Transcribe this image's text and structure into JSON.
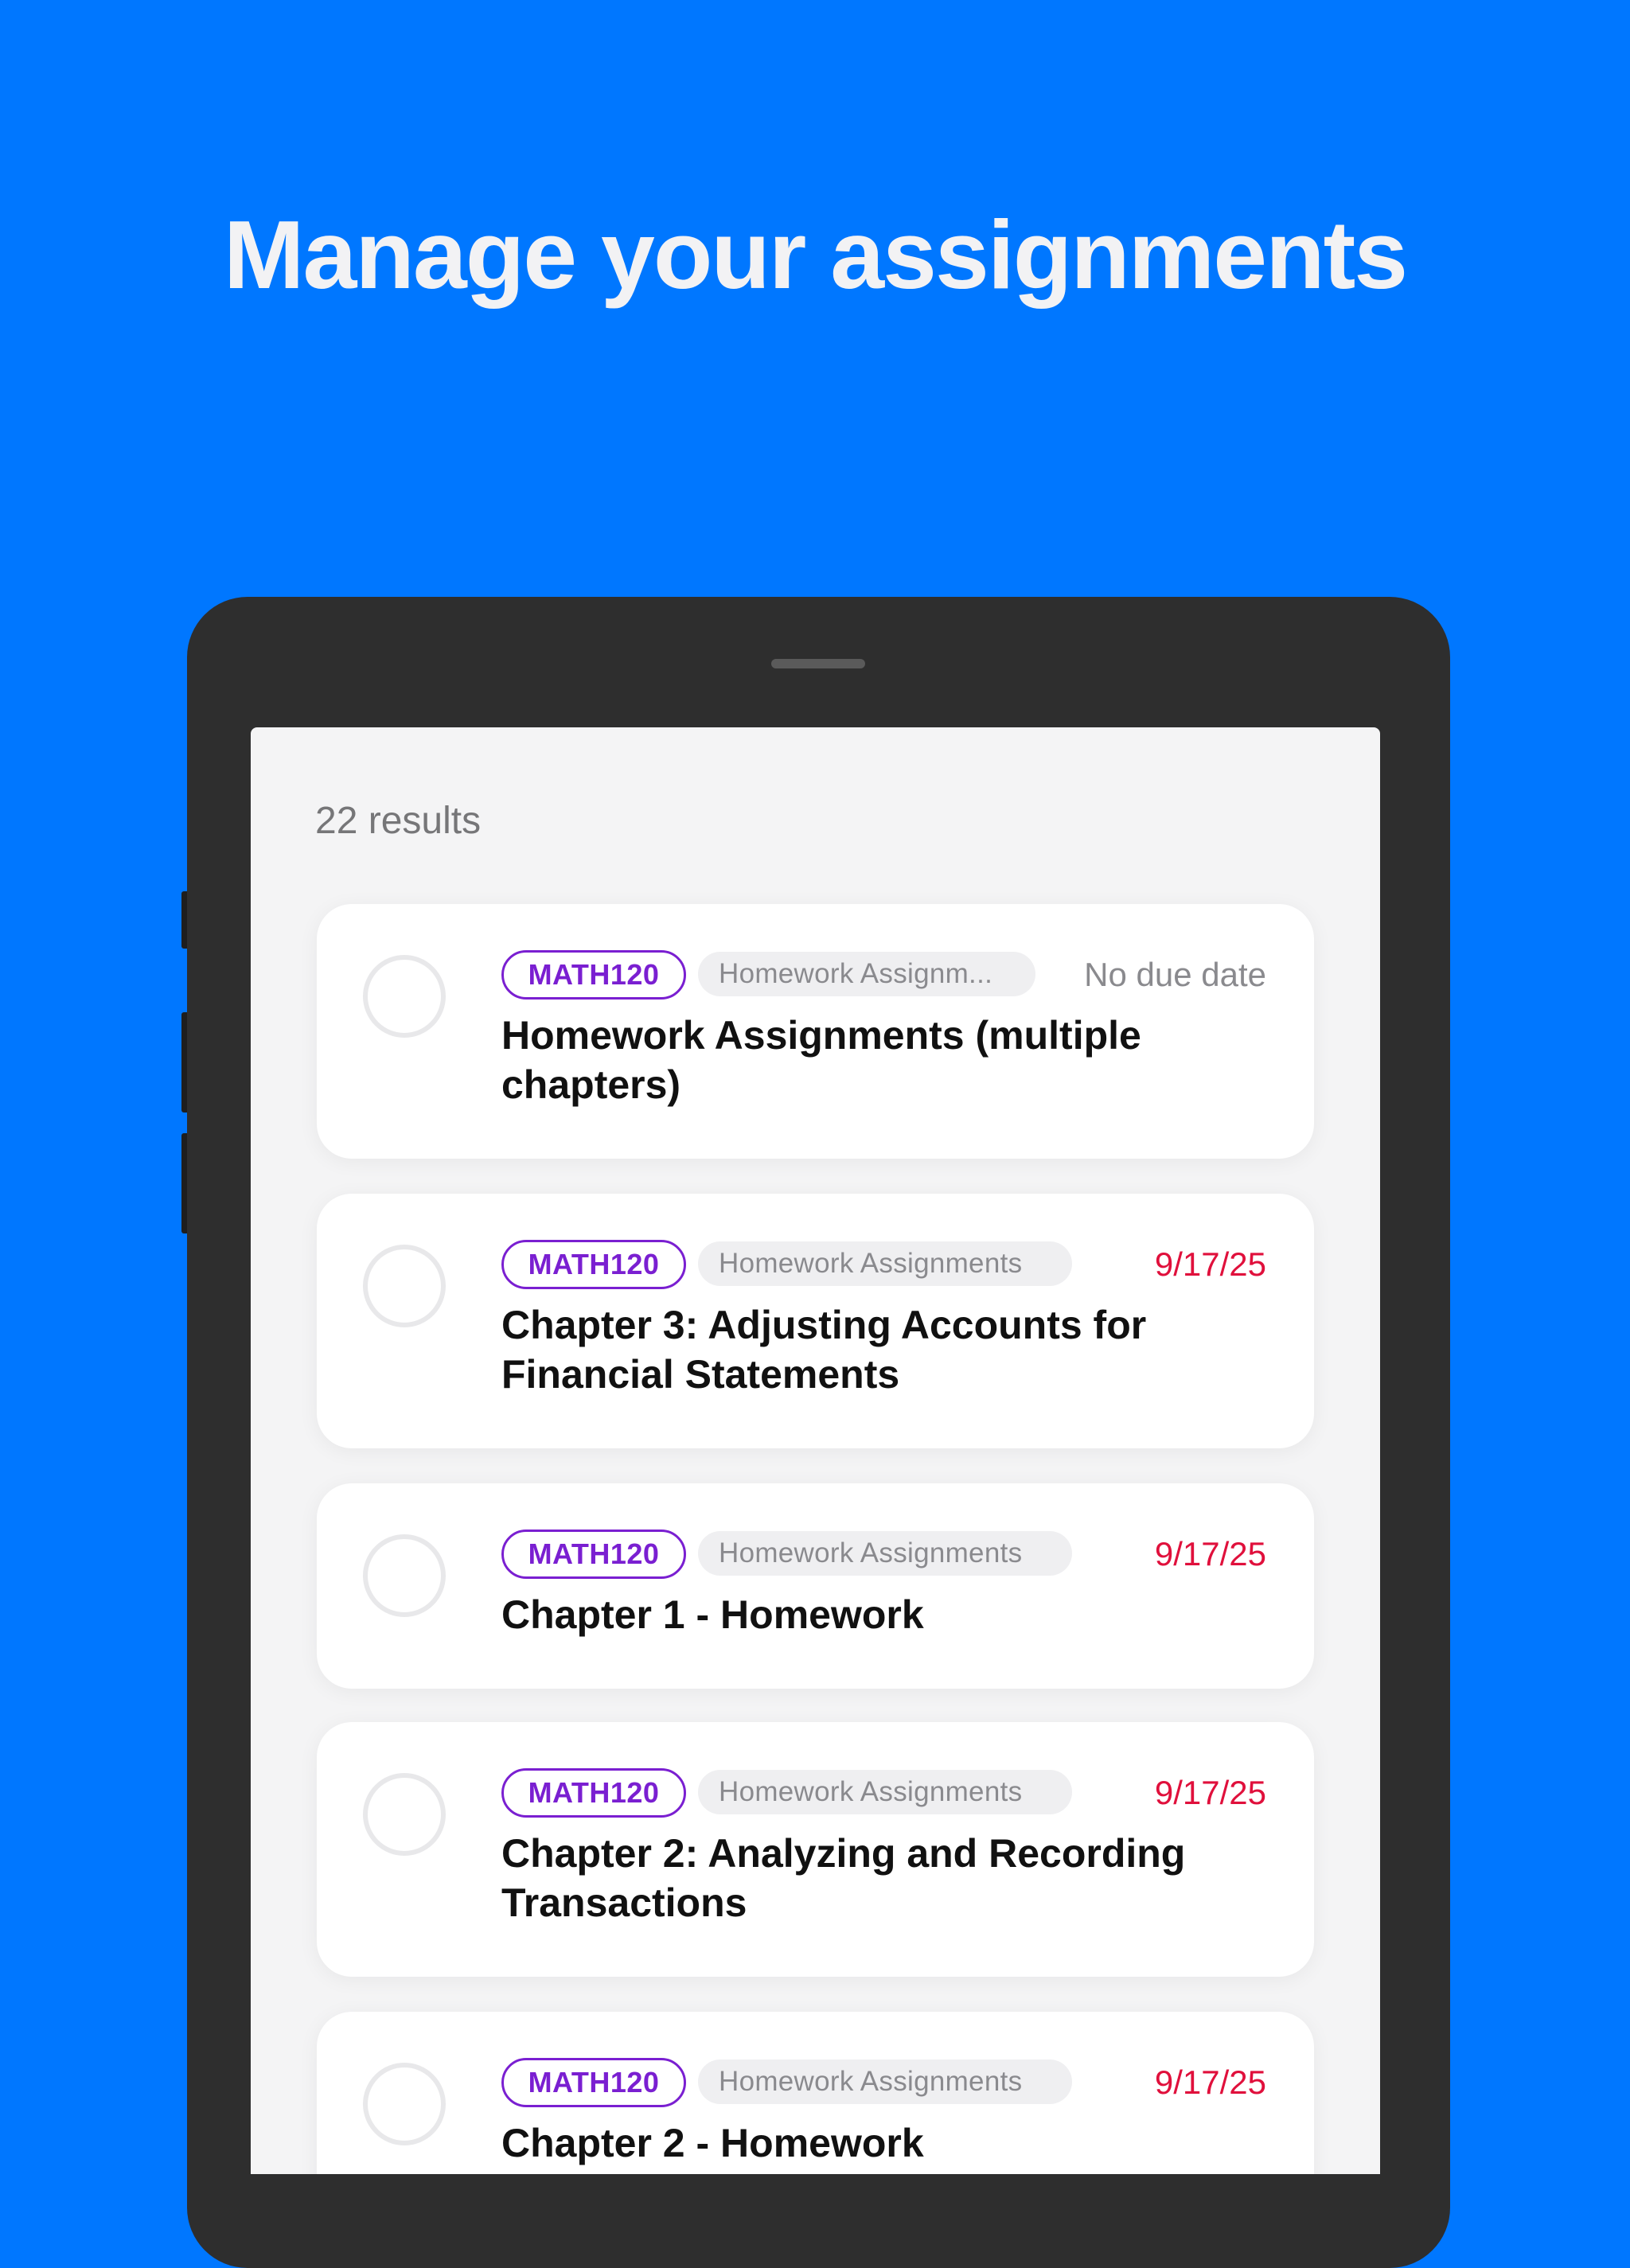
{
  "headline": "Manage your assignments",
  "list": {
    "results_text": "22 results",
    "items": [
      {
        "course": "MATH120",
        "category": "Homework Assignm...",
        "due": "No due date",
        "title": "Homework Assignments (multiple chapters)",
        "completed": false
      },
      {
        "course": "MATH120",
        "category": "Homework Assignments",
        "due": "9/17/25",
        "title": "Chapter 3: Adjusting Accounts for Financial Statements",
        "completed": false
      },
      {
        "course": "MATH120",
        "category": "Homework Assignments",
        "due": "9/17/25",
        "title": "Chapter 1 - Homework",
        "completed": false
      },
      {
        "course": "MATH120",
        "category": "Homework Assignments",
        "due": "9/17/25",
        "title": "Chapter 2: Analyzing and Recording Transactions",
        "completed": false
      },
      {
        "course": "MATH120",
        "category": "Homework Assignments",
        "due": "9/17/25",
        "title": "Chapter 2 - Homework",
        "completed": false
      }
    ]
  },
  "colors": {
    "background": "#0077FF",
    "course_chip": "#7A1FD1",
    "due_date": "#E0103C",
    "tablet_frame": "#2E2E2E"
  }
}
